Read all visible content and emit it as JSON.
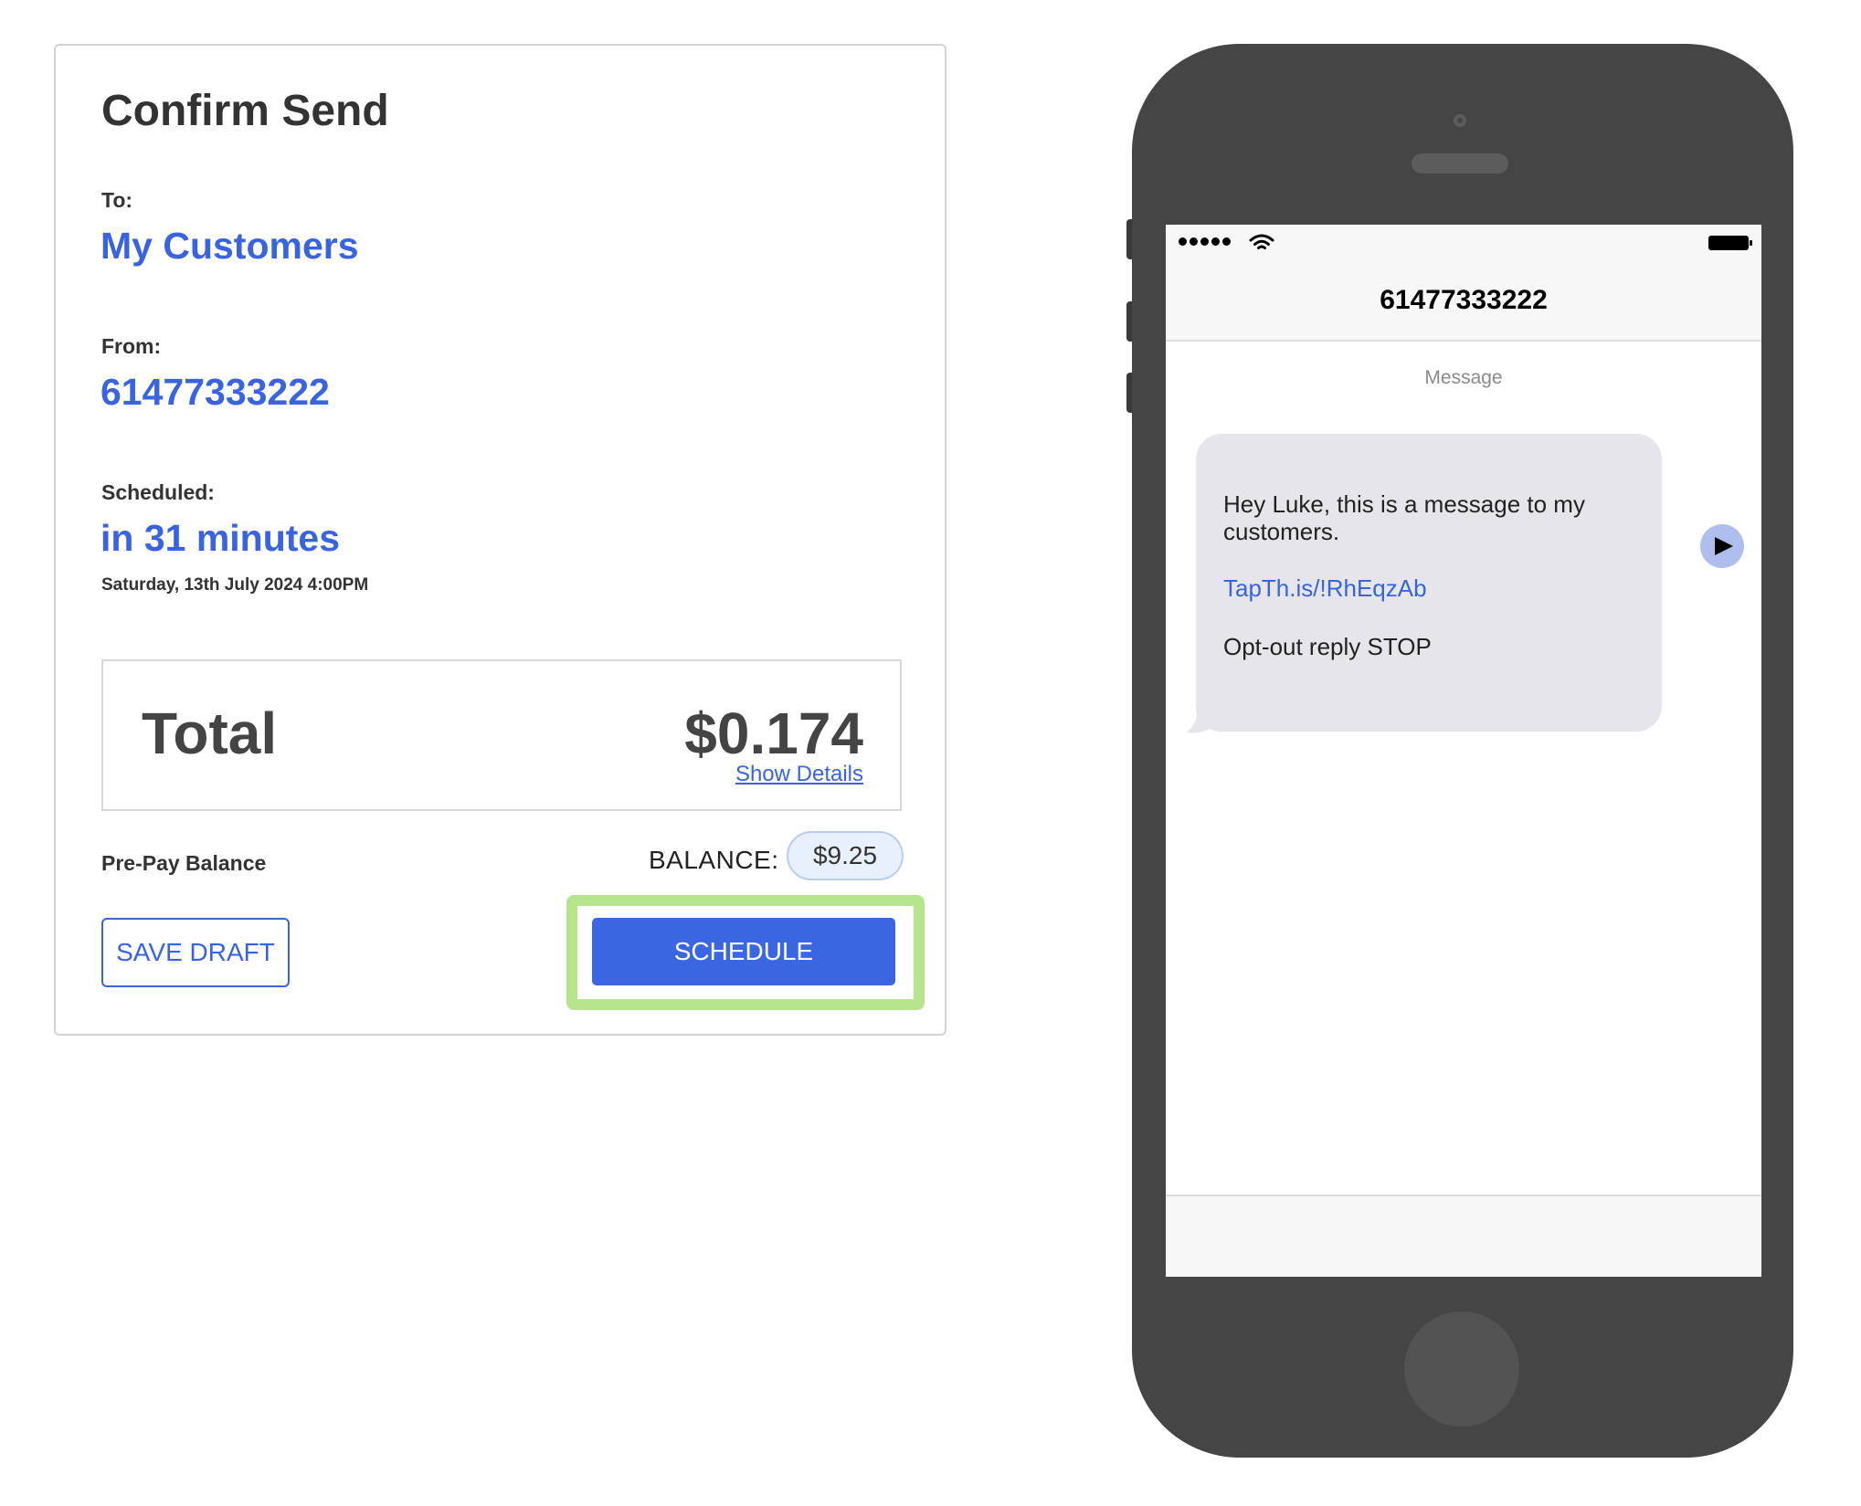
{
  "confirm": {
    "title": "Confirm Send",
    "to_label": "To:",
    "to_value": "My Customers",
    "from_label": "From:",
    "from_value": "61477333222",
    "scheduled_label": "Scheduled:",
    "scheduled_value": "in 31 minutes",
    "scheduled_datetime": "Saturday, 13th July 2024 4:00PM",
    "total_label": "Total",
    "total_amount": "$0.174",
    "show_details": "Show Details",
    "prepay_label": "Pre-Pay Balance",
    "balance_label": "BALANCE:",
    "balance_value": "$9.25",
    "save_draft_label": "SAVE DRAFT",
    "schedule_label": "SCHEDULE"
  },
  "phone": {
    "contact": "61477333222",
    "section_label": "Message",
    "message": {
      "line": "Hey Luke, this is a message to my customers.",
      "link": "TapTh.is/!RhEqzAb",
      "optout": "Opt-out reply STOP"
    },
    "icons": {
      "signal": "signal-dots-icon",
      "wifi": "wifi-icon",
      "battery": "battery-icon",
      "play": "play-icon"
    }
  },
  "colors": {
    "accent": "#3a63e0",
    "highlight": "#b5e48c",
    "phone_body": "#454545",
    "bubble": "#e5e5ea"
  }
}
